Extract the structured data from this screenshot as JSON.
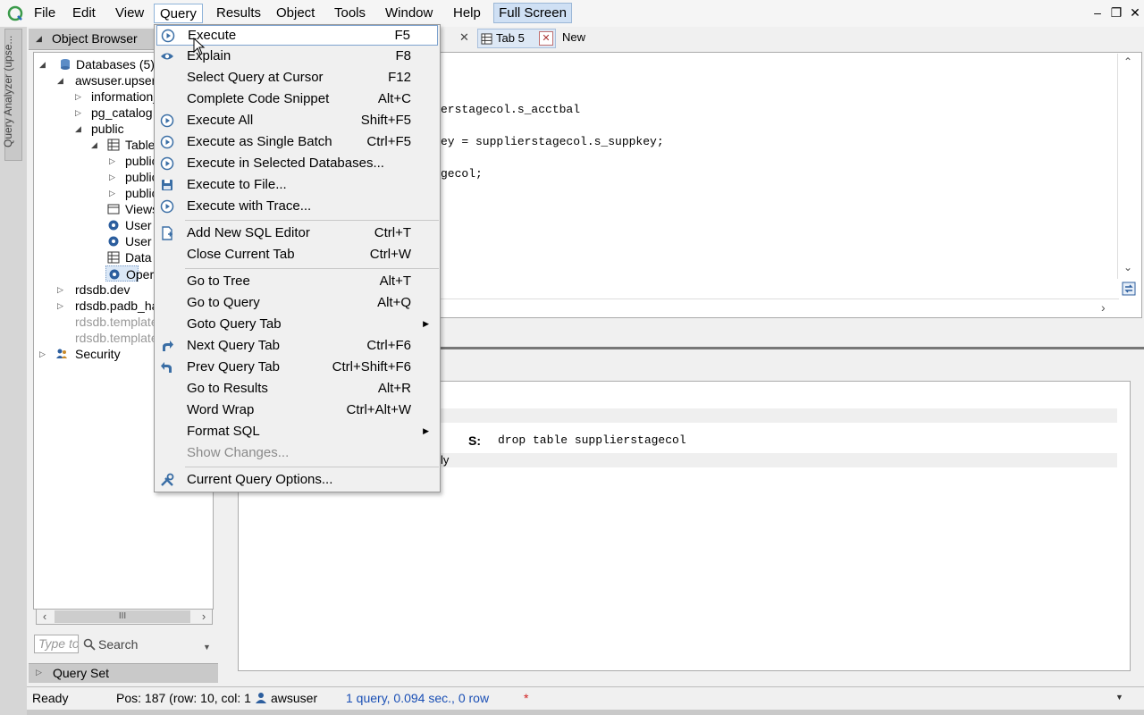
{
  "menubar": {
    "items": [
      "File",
      "Edit",
      "View",
      "Query",
      "Results",
      "Object",
      "Tools",
      "Window",
      "Help"
    ],
    "fullscreen": "Full Screen"
  },
  "side_tab": {
    "label": "Query Analyzer (upse..."
  },
  "object_browser": {
    "title": "Object Browser",
    "tree": [
      {
        "label": "Databases (5)"
      },
      {
        "label": "awsuser.upsert"
      },
      {
        "label": "information_"
      },
      {
        "label": "pg_catalog"
      },
      {
        "label": "public"
      },
      {
        "label": "Table"
      },
      {
        "label": "public"
      },
      {
        "label": "public"
      },
      {
        "label": "public"
      },
      {
        "label": "Views"
      },
      {
        "label": "User"
      },
      {
        "label": "User"
      },
      {
        "label": "Data"
      },
      {
        "label": "Oper"
      },
      {
        "label": "rdsdb.dev"
      },
      {
        "label": "rdsdb.padb_ha"
      },
      {
        "label": "rdsdb.template"
      },
      {
        "label": "rdsdb.template"
      },
      {
        "label": "Security"
      }
    ],
    "search_placeholder": "Type to",
    "search_label": "Search",
    "query_set": "Query Set"
  },
  "tabs": {
    "tab5": "Tab 5",
    "new": "New"
  },
  "editor": {
    "lines": [
      "erstagecol.s_acctbal",
      "ey = supplierstagecol.s_suppkey;",
      "gecol;"
    ]
  },
  "results": {
    "s_label": "S:",
    "statement": "drop table supplierstagecol",
    "row2": "ly"
  },
  "status": {
    "ready": "Ready",
    "position": "Pos: 187 (row: 10, col: 1",
    "user": "awsuser",
    "query_info": "1 query, 0.094 sec., 0 row",
    "modified": "*"
  },
  "query_menu": {
    "items": [
      {
        "label": "Execute",
        "shortcut": "F5",
        "icon": "play-icon"
      },
      {
        "label": "Explain",
        "shortcut": "F8",
        "icon": "eye-icon"
      },
      {
        "label": "Select Query at Cursor",
        "shortcut": "F12",
        "icon": ""
      },
      {
        "label": "Complete Code Snippet",
        "shortcut": "Alt+C",
        "icon": ""
      },
      {
        "label": "Execute All",
        "shortcut": "Shift+F5",
        "icon": "play-icon"
      },
      {
        "label": "Execute as Single Batch",
        "shortcut": "Ctrl+F5",
        "icon": "play-icon"
      },
      {
        "label": "Execute in Selected Databases...",
        "shortcut": "",
        "icon": "play-icon"
      },
      {
        "label": "Execute to File...",
        "shortcut": "",
        "icon": "save-icon"
      },
      {
        "label": "Execute with Trace...",
        "shortcut": "",
        "icon": "play-icon"
      },
      {
        "label": "Add New SQL Editor",
        "shortcut": "Ctrl+T",
        "icon": "new-editor-icon"
      },
      {
        "label": "Close Current Tab",
        "shortcut": "Ctrl+W",
        "icon": ""
      },
      {
        "label": "Go to Tree",
        "shortcut": "Alt+T",
        "icon": ""
      },
      {
        "label": "Go to Query",
        "shortcut": "Alt+Q",
        "icon": ""
      },
      {
        "label": "Goto Query Tab",
        "shortcut": "",
        "icon": "",
        "submenu": true
      },
      {
        "label": "Next Query Tab",
        "shortcut": "Ctrl+F6",
        "icon": "redo-arrow-icon"
      },
      {
        "label": "Prev Query Tab",
        "shortcut": "Ctrl+Shift+F6",
        "icon": "undo-arrow-icon"
      },
      {
        "label": "Go to Results",
        "shortcut": "Alt+R",
        "icon": ""
      },
      {
        "label": "Word Wrap",
        "shortcut": "Ctrl+Alt+W",
        "icon": ""
      },
      {
        "label": "Format SQL",
        "shortcut": "",
        "icon": "",
        "submenu": true
      },
      {
        "label": "Show Changes...",
        "shortcut": "",
        "icon": "",
        "disabled": true
      },
      {
        "label": "Current Query Options...",
        "shortcut": "",
        "icon": "tools-icon"
      }
    ]
  }
}
